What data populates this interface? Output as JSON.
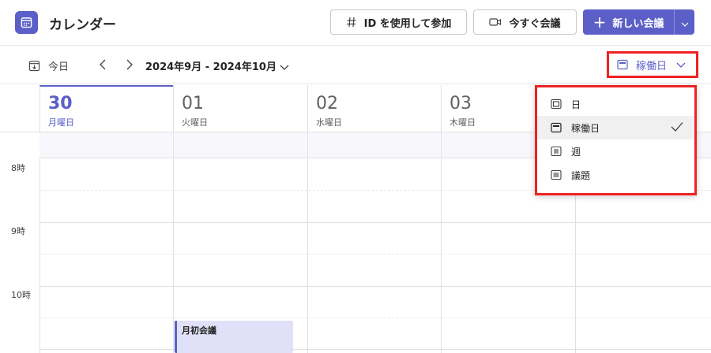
{
  "header": {
    "title": "カレンダー",
    "join_label": "ID を使用して参加",
    "meet_now_label": "今すぐ会議",
    "new_meeting_label": "新しい会議",
    "new_meeting_plus": "+"
  },
  "toolbar": {
    "today_label": "今日",
    "date_range": "2024年9月 - 2024年10月",
    "view_label": "稼働日"
  },
  "days": [
    {
      "num": "30",
      "dow": "月曜日",
      "active": true
    },
    {
      "num": "01",
      "dow": "火曜日",
      "active": false
    },
    {
      "num": "02",
      "dow": "水曜日",
      "active": false
    },
    {
      "num": "03",
      "dow": "木曜日",
      "active": false
    }
  ],
  "time_labels": [
    "8時",
    "9時",
    "10時"
  ],
  "event": {
    "title": "月初会議"
  },
  "view_menu": {
    "items": [
      {
        "label": "日",
        "icon": "day-view-icon",
        "selected": false
      },
      {
        "label": "稼働日",
        "icon": "workweek-view-icon",
        "selected": true
      },
      {
        "label": "週",
        "icon": "week-view-icon",
        "selected": false
      },
      {
        "label": "議題",
        "icon": "agenda-view-icon",
        "selected": false
      }
    ]
  },
  "colors": {
    "accent": "#5b5fc7",
    "highlight_border": "#ee2222",
    "event_bg": "#e0e1f8"
  }
}
